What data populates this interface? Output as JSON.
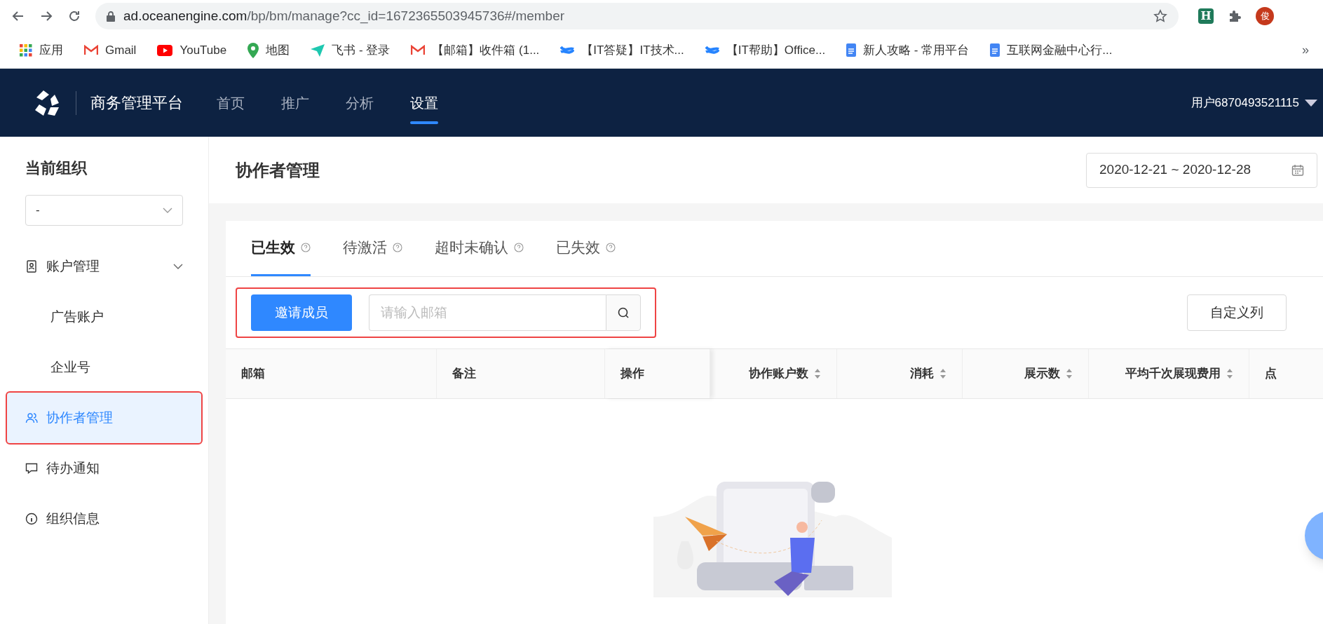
{
  "browser": {
    "url_host": "ad.oceanengine.com",
    "url_path": "/bp/bm/manage?cc_id=1672365503945736#/member",
    "extension_label": "H",
    "profile_initial": "俊",
    "bookmarks": [
      {
        "label": "应用",
        "kind": "apps"
      },
      {
        "label": "Gmail",
        "kind": "mail"
      },
      {
        "label": "YouTube",
        "kind": "video"
      },
      {
        "label": "地图",
        "kind": "pin"
      },
      {
        "label": "飞书 - 登录",
        "kind": "plane"
      },
      {
        "label": "【邮箱】收件箱 (1...",
        "kind": "mail"
      },
      {
        "label": "【IT答疑】IT技术...",
        "kind": "cross"
      },
      {
        "label": "【IT帮助】Office...",
        "kind": "cross"
      },
      {
        "label": "新人攻略 - 常用平台",
        "kind": "doc"
      },
      {
        "label": "互联网金融中心行...",
        "kind": "doc"
      }
    ],
    "more": "»"
  },
  "header": {
    "title": "商务管理平台",
    "nav": [
      {
        "label": "首页",
        "selected": false
      },
      {
        "label": "推广",
        "selected": false
      },
      {
        "label": "分析",
        "selected": false
      },
      {
        "label": "设置",
        "selected": true
      }
    ],
    "user": "用户6870493521115"
  },
  "sidebar": {
    "heading": "当前组织",
    "org_select": "-",
    "items": [
      {
        "label": "账户管理",
        "kind": "badge",
        "selected": false,
        "expanded": true,
        "children": [
          {
            "label": "广告账户",
            "selected": false
          },
          {
            "label": "企业号",
            "selected": false
          }
        ]
      },
      {
        "label": "协作者管理",
        "kind": "users",
        "selected": true
      },
      {
        "label": "待办通知",
        "kind": "message",
        "selected": false
      },
      {
        "label": "组织信息",
        "kind": "info",
        "selected": false
      }
    ]
  },
  "page": {
    "title": "协作者管理",
    "date_range": "2020-12-21 ~ 2020-12-28",
    "tabs": [
      {
        "label": "已生效",
        "selected": true
      },
      {
        "label": "待激活",
        "selected": false
      },
      {
        "label": "超时未确认",
        "selected": false
      },
      {
        "label": "已失效",
        "selected": false
      }
    ],
    "invite_button": "邀请成员",
    "search_placeholder": "请输入邮箱",
    "columns_button": "自定义列",
    "columns": [
      {
        "label": "邮箱",
        "sortable": false
      },
      {
        "label": "备注",
        "sortable": false
      },
      {
        "label": "操作",
        "sortable": false
      },
      {
        "label": "协作账户数",
        "sortable": true
      },
      {
        "label": "消耗",
        "sortable": true
      },
      {
        "label": "展示数",
        "sortable": true
      },
      {
        "label": "平均千次展现费用",
        "sortable": true
      },
      {
        "label": "点",
        "sortable": false
      }
    ]
  }
}
